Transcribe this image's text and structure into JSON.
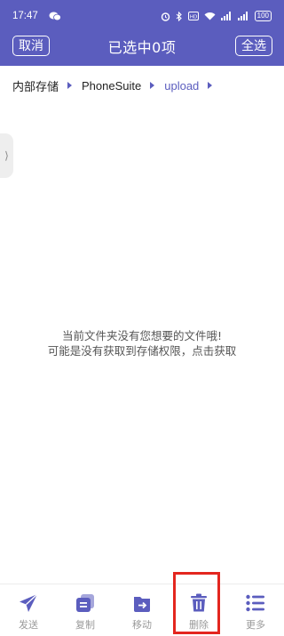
{
  "status_bar": {
    "time": "17:47",
    "battery": "100"
  },
  "header": {
    "title": "已选中0项",
    "cancel_label": "取消",
    "select_all_label": "全选"
  },
  "breadcrumb": [
    "内部存储",
    "PhoneSuite",
    "upload"
  ],
  "empty_state": {
    "line1": "当前文件夹没有您想要的文件哦!",
    "line2": "可能是没有获取到存储权限，点击获取"
  },
  "toolbar": {
    "items": [
      {
        "label": "发送",
        "icon": "send-icon"
      },
      {
        "label": "复制",
        "icon": "copy-icon"
      },
      {
        "label": "移动",
        "icon": "move-icon"
      },
      {
        "label": "删除",
        "icon": "trash-icon"
      },
      {
        "label": "更多",
        "icon": "more-list-icon"
      }
    ]
  },
  "colors": {
    "accent": "#5b5dbe",
    "highlight": "#e3261f",
    "muted": "#9a9a9a"
  }
}
